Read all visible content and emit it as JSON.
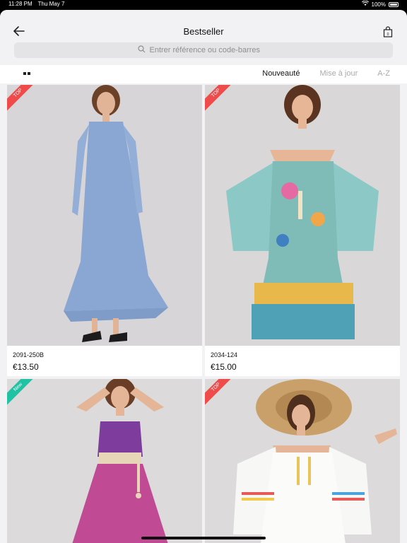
{
  "status": {
    "time": "11:28 PM",
    "date": "Thu May 7",
    "battery": "100%"
  },
  "nav": {
    "title": "Bestseller"
  },
  "search": {
    "placeholder": "Entrer référence ou code-barres"
  },
  "sort": {
    "options": [
      "Nouveauté",
      "Mise à jour",
      "A-Z"
    ],
    "active_index": 0
  },
  "colors": {
    "top_badge": "#ef4b4b",
    "new_badge": "#21c1a4",
    "accent": "#111111"
  },
  "products": [
    {
      "badge": "TOP",
      "ref": "2091-250B",
      "price": "€13.50",
      "image": "model-in-blue-floral-long-dress"
    },
    {
      "badge": "TOP",
      "ref": "2034-124",
      "price": "€15.00",
      "image": "model-in-colorful-off-shoulder-mini-dress"
    },
    {
      "badge": "New",
      "ref": "",
      "price": "",
      "image": "model-in-purple-patterned-dress"
    },
    {
      "badge": "TOP",
      "ref": "",
      "price": "",
      "image": "model-in-white-dress-with-straw-hat"
    }
  ]
}
